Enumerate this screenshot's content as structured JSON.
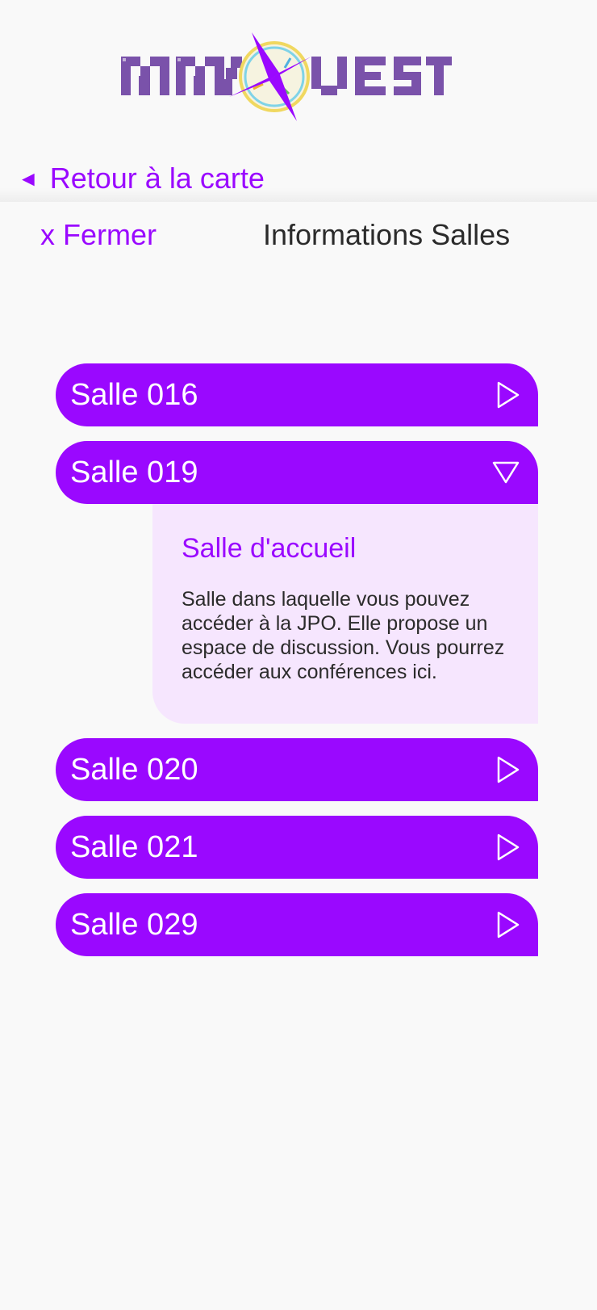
{
  "app": {
    "logo_text": "MMI QUEST",
    "brand_color": "#9a08ff",
    "logo_color": "#7a52aa"
  },
  "nav": {
    "back_icon": "left-triangle-icon",
    "back_label": "Retour à la carte"
  },
  "panel": {
    "close_label": "x Fermer",
    "title": "Informations Salles"
  },
  "rooms": [
    {
      "name": "Salle 016",
      "expanded": false,
      "icon": "play-right-icon"
    },
    {
      "name": "Salle 019",
      "expanded": true,
      "icon": "triangle-down-icon",
      "detail_title": "Salle d'accueil",
      "detail_text": "Salle dans laquelle vous pouvez accéder à la JPO. Elle propose un espace de discussion. Vous pourrez accéder aux conférences ici."
    },
    {
      "name": "Salle 020",
      "expanded": false,
      "icon": "play-right-icon"
    },
    {
      "name": "Salle 021",
      "expanded": false,
      "icon": "play-right-icon"
    },
    {
      "name": "Salle 029",
      "expanded": false,
      "icon": "play-right-icon"
    }
  ]
}
